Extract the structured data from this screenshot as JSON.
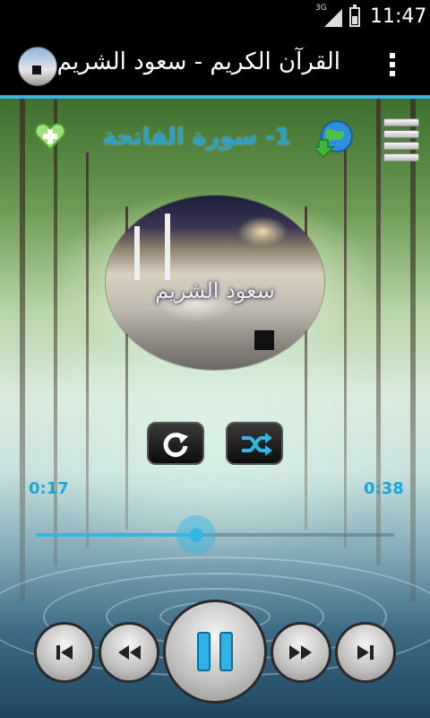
{
  "status_bar": {
    "network": "3G",
    "clock": "11:47"
  },
  "action_bar": {
    "title": "القرآن الكريم - سعود الشريم",
    "menu_icon": "overflow-menu-icon"
  },
  "player": {
    "track_title": "1- سورة الفاتحة",
    "album_label": "سعود الشريم",
    "time_elapsed": "0:17",
    "time_total": "0:38",
    "progress_fraction": 0.4474,
    "state": "playing"
  },
  "icons": {
    "favorite": "heart-plus-icon",
    "download": "globe-download-icon",
    "playlist": "playlist-icon",
    "repeat": "repeat-icon",
    "shuffle": "shuffle-icon",
    "previous": "skip-previous-icon",
    "rewind": "rewind-icon",
    "pause": "pause-icon",
    "fast_forward": "fast-forward-icon",
    "next": "skip-next-icon"
  },
  "colors": {
    "accent": "#33b5e5",
    "title_text": "#2aa0c8",
    "time_text": "#1ea7d6"
  }
}
